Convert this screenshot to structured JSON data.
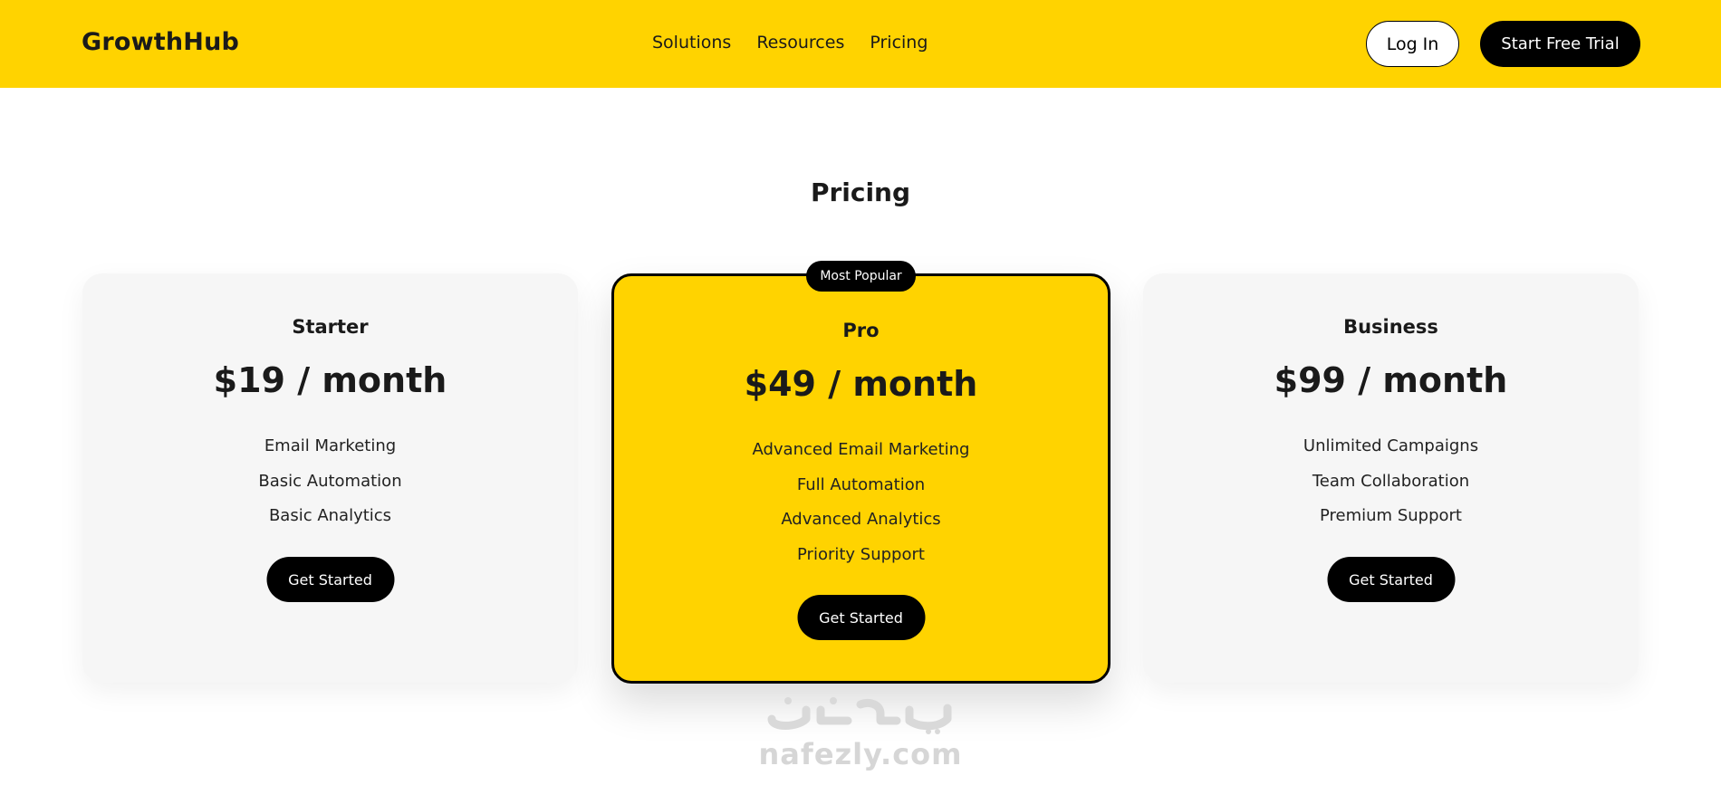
{
  "header": {
    "brand": "GrowthHub",
    "nav": [
      "Solutions",
      "Resources",
      "Pricing"
    ],
    "login_label": "Log In",
    "trial_label": "Start Free Trial"
  },
  "main": {
    "title": "Pricing",
    "plans": [
      {
        "name": "Starter",
        "price": "$19 / month",
        "features": [
          "Email Marketing",
          "Basic Automation",
          "Basic Analytics"
        ],
        "cta": "Get Started"
      },
      {
        "name": "Pro",
        "badge": "Most Popular",
        "price": "$49 / month",
        "features": [
          "Advanced Email Marketing",
          "Full Automation",
          "Advanced Analytics",
          "Priority Support"
        ],
        "cta": "Get Started"
      },
      {
        "name": "Business",
        "price": "$99 / month",
        "features": [
          "Unlimited Campaigns",
          "Team Collaboration",
          "Premium Support"
        ],
        "cta": "Get Started"
      }
    ]
  },
  "watermark": {
    "text": "nafezly.com",
    "logo_text": "نفذلي"
  },
  "colors": {
    "accent": "#FFD300",
    "dark": "#000000",
    "card_bg": "#F6F6F6"
  }
}
